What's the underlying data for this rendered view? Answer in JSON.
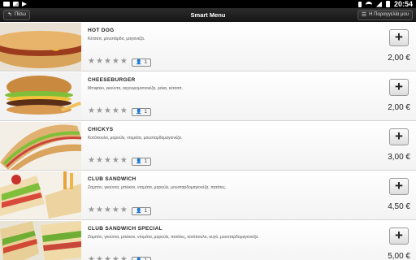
{
  "status_bar": {
    "time": "20:54",
    "icons": [
      "notification-icon",
      "image-icon",
      "play-store-icon",
      "bluetooth-icon",
      "wifi-icon",
      "signal-icon",
      "battery-icon"
    ]
  },
  "toolbar": {
    "back_label": "Πίσω",
    "title": "Smart Menu",
    "order_label": "Η Παραγγελία μου"
  },
  "currency": "€",
  "items": [
    {
      "name": "HOT DOG",
      "description": "Κέτσαπ, μουστάρδα, μαγιονέζα.",
      "rating_stars": 5,
      "quantity": "1",
      "price": "2,00 €",
      "photo": "hotdog"
    },
    {
      "name": "CHEESEBURGER",
      "description": "Μπιφτέκι, γκούντα, αγγουροματιονέζα, ρόκα, κέτσαπ.",
      "rating_stars": 5,
      "quantity": "1",
      "price": "2,00 €",
      "photo": "burger"
    },
    {
      "name": "CHICKYS",
      "description": "Κοτόπουλο, μαρούλι, ντομάτα, μουσταρδομαγιονέζα.",
      "rating_stars": 5,
      "quantity": "1",
      "price": "3,00 €",
      "photo": "chickys"
    },
    {
      "name": "CLUB SANDWICH",
      "description": "Ζαμπόν, γκούντα, μπέικον, ντομάτα, μαρούλι, μουσταρδομαγιονέζα, πατάτες.",
      "rating_stars": 5,
      "quantity": "1",
      "price": "4,50 €",
      "photo": "club"
    },
    {
      "name": "CLUB SANDWICH SPECIAL",
      "description": "Ζαμπόν, γκούντα, μπέικον, ντομάτα, μαρούλι, πατάτες, κοτόπουλο, αυγό, μουσταρδομαγιονέζα.",
      "rating_stars": 5,
      "quantity": "1",
      "price": "5,00 €",
      "photo": "clubspecial"
    }
  ]
}
